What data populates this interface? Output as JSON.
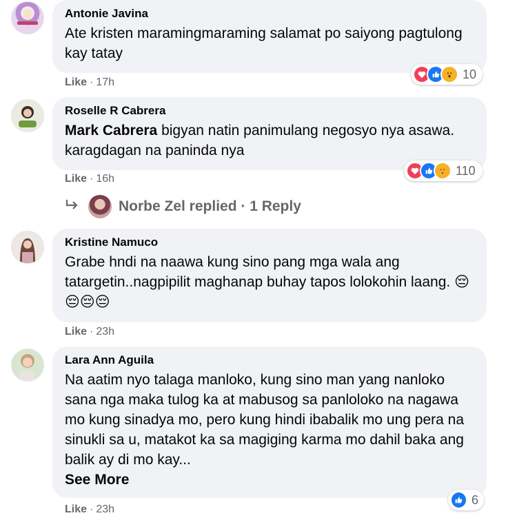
{
  "comments": [
    {
      "author": "Antonie Javina",
      "text": "Ate kristen maramingmaraming salamat po saiyong pagtulong kay tatay",
      "like_label": "Like",
      "time": "17h",
      "reaction_icons": [
        "love-reaction-icon",
        "like-reaction-icon",
        "wow-reaction-icon"
      ],
      "reaction_count": "10"
    },
    {
      "author": "Roselle R Cabrera",
      "mention": "Mark Cabrera",
      "text": " bigyan natin panimulang negosyo nya asawa. karagdagan na paninda nya",
      "like_label": "Like",
      "time": "16h",
      "reaction_icons": [
        "love-reaction-icon",
        "like-reaction-icon",
        "care-reaction-icon"
      ],
      "reaction_count": "110",
      "replies_text": "Norbe Zel replied · 1 Reply"
    },
    {
      "author": "Kristine Namuco",
      "text": "Grabe hndi na naawa kung sino pang mga wala ang tatargetin..nagpipilit maghanap buhay tapos lolokohin laang. 😔😔😔😔",
      "like_label": "Like",
      "time": "23h"
    },
    {
      "author": "Lara Ann Aguila",
      "text": "Na aatim nyo talaga manloko, kung sino man yang nanloko sana nga maka tulog ka at mabusog sa panloloko na nagawa mo kung sinadya mo, pero kung hindi ibabalik mo ung pera na sinukli sa u, matakot ka sa magiging karma mo dahil baka ang balik ay di mo kay...",
      "see_more": "See More",
      "like_label": "Like",
      "time": "23h",
      "reaction_icons": [
        "like-reaction-icon"
      ],
      "reaction_count": "6"
    }
  ],
  "colors": {
    "bubble": "#f0f2f5",
    "meta_text": "#65676b",
    "like_blue": "#1877f2",
    "love_red": "#f33e58",
    "wow_yellow": "#f7b125"
  }
}
